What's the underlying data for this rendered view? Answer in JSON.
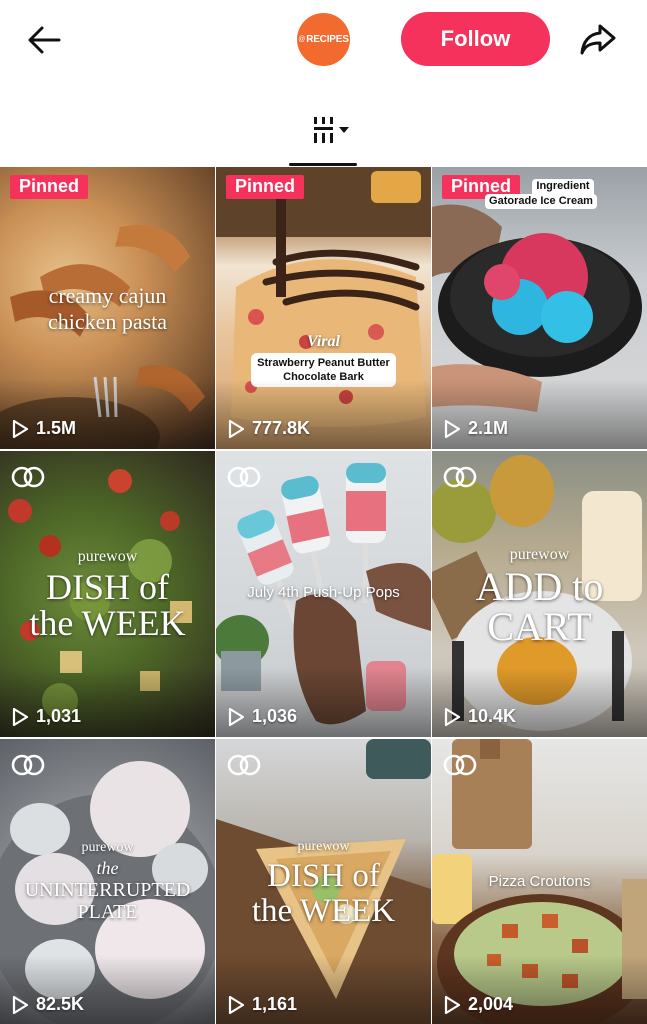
{
  "header": {
    "avatar_text": "RECIPES",
    "avatar_prefix": "@",
    "follow_label": "Follow",
    "accent_color": "#f4325b",
    "avatar_color": "#f26a2e"
  },
  "icons": {
    "back": "arrow-left-icon",
    "share": "share-arrow-icon",
    "sort": "grid-sort-icon",
    "play": "play-icon",
    "collab": "collab-icon"
  },
  "videos": [
    {
      "pinned": "Pinned",
      "title_line1": "creamy cajun",
      "title_line2": "chicken pasta",
      "views": "1.5M"
    },
    {
      "pinned": "Pinned",
      "tag": "Viral",
      "title_line1": "Strawberry Peanut Butter",
      "title_line2": "Chocolate Bark",
      "views": "777.8K"
    },
    {
      "pinned": "Pinned",
      "title_line1": "Ingredient",
      "title_line2": "Gatorade Ice Cream",
      "views": "2.1M"
    },
    {
      "brand": "purewow",
      "title_line1": "DISH of",
      "title_line2": "the WEEK",
      "views": "1,031"
    },
    {
      "title_line1": "July 4th Push-Up Pops",
      "views": "1,036"
    },
    {
      "brand": "purewow",
      "title_line1": "ADD to",
      "title_line2": "CART",
      "views": "10.4K"
    },
    {
      "brand": "purewow",
      "title_line0": "the",
      "title_line1": "UNINTERRUPTED",
      "title_line2": "PLATE",
      "views": "82.5K"
    },
    {
      "brand": "purewow",
      "title_line1": "DISH of",
      "title_line2": "the WEEK",
      "views": "1,161"
    },
    {
      "title_line1": "Pizza Croutons",
      "views": "2,004"
    }
  ]
}
